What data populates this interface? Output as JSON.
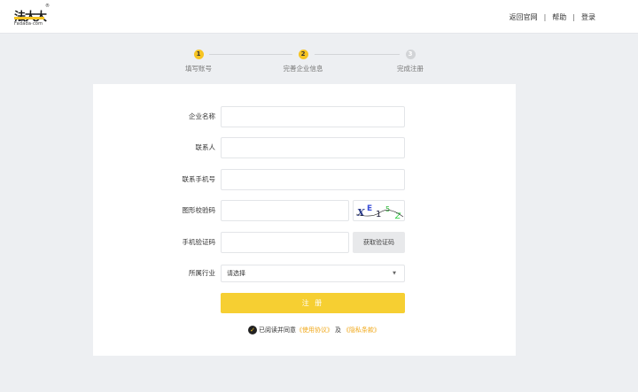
{
  "header": {
    "logo_text": "法大大",
    "logo_subtext": "Fadada·com",
    "logo_reg": "®",
    "nav": [
      "返回官网",
      "帮助",
      "登录"
    ],
    "separator": "|"
  },
  "steps": [
    {
      "number": "1",
      "label": "填写账号",
      "active": true
    },
    {
      "number": "2",
      "label": "完善企业信息",
      "active": true
    },
    {
      "number": "3",
      "label": "完成注册",
      "active": false
    }
  ],
  "form": {
    "company_name_label": "企业名称",
    "contact_label": "联系人",
    "phone_label": "联系手机号",
    "captcha_label": "图形校验码",
    "sms_code_label": "手机验证码",
    "sms_button": "获取验证码",
    "industry_label": "所属行业",
    "industry_value": "请选择",
    "submit_label": "注 册",
    "agree_prefix": "已阅读并同意",
    "terms_link": "《使用协议》",
    "agree_and": "及",
    "privacy_link": "《隐私条款》"
  },
  "captcha_chars": [
    "X",
    "E",
    "1",
    "5",
    "Z"
  ],
  "colors": {
    "accent": "#f6cf32",
    "link": "#f0a81a",
    "background": "#edeff2"
  }
}
